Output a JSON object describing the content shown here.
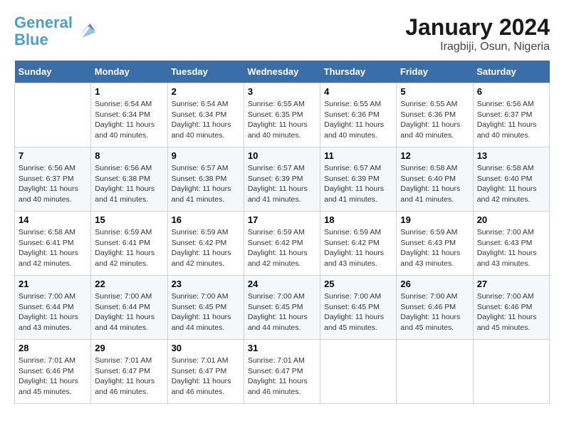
{
  "logo": {
    "line1": "General",
    "line2": "Blue"
  },
  "title": "January 2024",
  "subtitle": "Iragbiji, Osun, Nigeria",
  "weekdays": [
    "Sunday",
    "Monday",
    "Tuesday",
    "Wednesday",
    "Thursday",
    "Friday",
    "Saturday"
  ],
  "weeks": [
    [
      {
        "day": "",
        "sunrise": "",
        "sunset": "",
        "daylight": ""
      },
      {
        "day": "1",
        "sunrise": "Sunrise: 6:54 AM",
        "sunset": "Sunset: 6:34 PM",
        "daylight": "Daylight: 11 hours and 40 minutes."
      },
      {
        "day": "2",
        "sunrise": "Sunrise: 6:54 AM",
        "sunset": "Sunset: 6:34 PM",
        "daylight": "Daylight: 11 hours and 40 minutes."
      },
      {
        "day": "3",
        "sunrise": "Sunrise: 6:55 AM",
        "sunset": "Sunset: 6:35 PM",
        "daylight": "Daylight: 11 hours and 40 minutes."
      },
      {
        "day": "4",
        "sunrise": "Sunrise: 6:55 AM",
        "sunset": "Sunset: 6:36 PM",
        "daylight": "Daylight: 11 hours and 40 minutes."
      },
      {
        "day": "5",
        "sunrise": "Sunrise: 6:55 AM",
        "sunset": "Sunset: 6:36 PM",
        "daylight": "Daylight: 11 hours and 40 minutes."
      },
      {
        "day": "6",
        "sunrise": "Sunrise: 6:56 AM",
        "sunset": "Sunset: 6:37 PM",
        "daylight": "Daylight: 11 hours and 40 minutes."
      }
    ],
    [
      {
        "day": "7",
        "sunrise": "Sunrise: 6:56 AM",
        "sunset": "Sunset: 6:37 PM",
        "daylight": "Daylight: 11 hours and 40 minutes."
      },
      {
        "day": "8",
        "sunrise": "Sunrise: 6:56 AM",
        "sunset": "Sunset: 6:38 PM",
        "daylight": "Daylight: 11 hours and 41 minutes."
      },
      {
        "day": "9",
        "sunrise": "Sunrise: 6:57 AM",
        "sunset": "Sunset: 6:38 PM",
        "daylight": "Daylight: 11 hours and 41 minutes."
      },
      {
        "day": "10",
        "sunrise": "Sunrise: 6:57 AM",
        "sunset": "Sunset: 6:39 PM",
        "daylight": "Daylight: 11 hours and 41 minutes."
      },
      {
        "day": "11",
        "sunrise": "Sunrise: 6:57 AM",
        "sunset": "Sunset: 6:39 PM",
        "daylight": "Daylight: 11 hours and 41 minutes."
      },
      {
        "day": "12",
        "sunrise": "Sunrise: 6:58 AM",
        "sunset": "Sunset: 6:40 PM",
        "daylight": "Daylight: 11 hours and 41 minutes."
      },
      {
        "day": "13",
        "sunrise": "Sunrise: 6:58 AM",
        "sunset": "Sunset: 6:40 PM",
        "daylight": "Daylight: 11 hours and 42 minutes."
      }
    ],
    [
      {
        "day": "14",
        "sunrise": "Sunrise: 6:58 AM",
        "sunset": "Sunset: 6:41 PM",
        "daylight": "Daylight: 11 hours and 42 minutes."
      },
      {
        "day": "15",
        "sunrise": "Sunrise: 6:59 AM",
        "sunset": "Sunset: 6:41 PM",
        "daylight": "Daylight: 11 hours and 42 minutes."
      },
      {
        "day": "16",
        "sunrise": "Sunrise: 6:59 AM",
        "sunset": "Sunset: 6:42 PM",
        "daylight": "Daylight: 11 hours and 42 minutes."
      },
      {
        "day": "17",
        "sunrise": "Sunrise: 6:59 AM",
        "sunset": "Sunset: 6:42 PM",
        "daylight": "Daylight: 11 hours and 42 minutes."
      },
      {
        "day": "18",
        "sunrise": "Sunrise: 6:59 AM",
        "sunset": "Sunset: 6:42 PM",
        "daylight": "Daylight: 11 hours and 43 minutes."
      },
      {
        "day": "19",
        "sunrise": "Sunrise: 6:59 AM",
        "sunset": "Sunset: 6:43 PM",
        "daylight": "Daylight: 11 hours and 43 minutes."
      },
      {
        "day": "20",
        "sunrise": "Sunrise: 7:00 AM",
        "sunset": "Sunset: 6:43 PM",
        "daylight": "Daylight: 11 hours and 43 minutes."
      }
    ],
    [
      {
        "day": "21",
        "sunrise": "Sunrise: 7:00 AM",
        "sunset": "Sunset: 6:44 PM",
        "daylight": "Daylight: 11 hours and 43 minutes."
      },
      {
        "day": "22",
        "sunrise": "Sunrise: 7:00 AM",
        "sunset": "Sunset: 6:44 PM",
        "daylight": "Daylight: 11 hours and 44 minutes."
      },
      {
        "day": "23",
        "sunrise": "Sunrise: 7:00 AM",
        "sunset": "Sunset: 6:45 PM",
        "daylight": "Daylight: 11 hours and 44 minutes."
      },
      {
        "day": "24",
        "sunrise": "Sunrise: 7:00 AM",
        "sunset": "Sunset: 6:45 PM",
        "daylight": "Daylight: 11 hours and 44 minutes."
      },
      {
        "day": "25",
        "sunrise": "Sunrise: 7:00 AM",
        "sunset": "Sunset: 6:45 PM",
        "daylight": "Daylight: 11 hours and 45 minutes."
      },
      {
        "day": "26",
        "sunrise": "Sunrise: 7:00 AM",
        "sunset": "Sunset: 6:46 PM",
        "daylight": "Daylight: 11 hours and 45 minutes."
      },
      {
        "day": "27",
        "sunrise": "Sunrise: 7:00 AM",
        "sunset": "Sunset: 6:46 PM",
        "daylight": "Daylight: 11 hours and 45 minutes."
      }
    ],
    [
      {
        "day": "28",
        "sunrise": "Sunrise: 7:01 AM",
        "sunset": "Sunset: 6:46 PM",
        "daylight": "Daylight: 11 hours and 45 minutes."
      },
      {
        "day": "29",
        "sunrise": "Sunrise: 7:01 AM",
        "sunset": "Sunset: 6:47 PM",
        "daylight": "Daylight: 11 hours and 46 minutes."
      },
      {
        "day": "30",
        "sunrise": "Sunrise: 7:01 AM",
        "sunset": "Sunset: 6:47 PM",
        "daylight": "Daylight: 11 hours and 46 minutes."
      },
      {
        "day": "31",
        "sunrise": "Sunrise: 7:01 AM",
        "sunset": "Sunset: 6:47 PM",
        "daylight": "Daylight: 11 hours and 46 minutes."
      },
      {
        "day": "",
        "sunrise": "",
        "sunset": "",
        "daylight": ""
      },
      {
        "day": "",
        "sunrise": "",
        "sunset": "",
        "daylight": ""
      },
      {
        "day": "",
        "sunrise": "",
        "sunset": "",
        "daylight": ""
      }
    ]
  ]
}
